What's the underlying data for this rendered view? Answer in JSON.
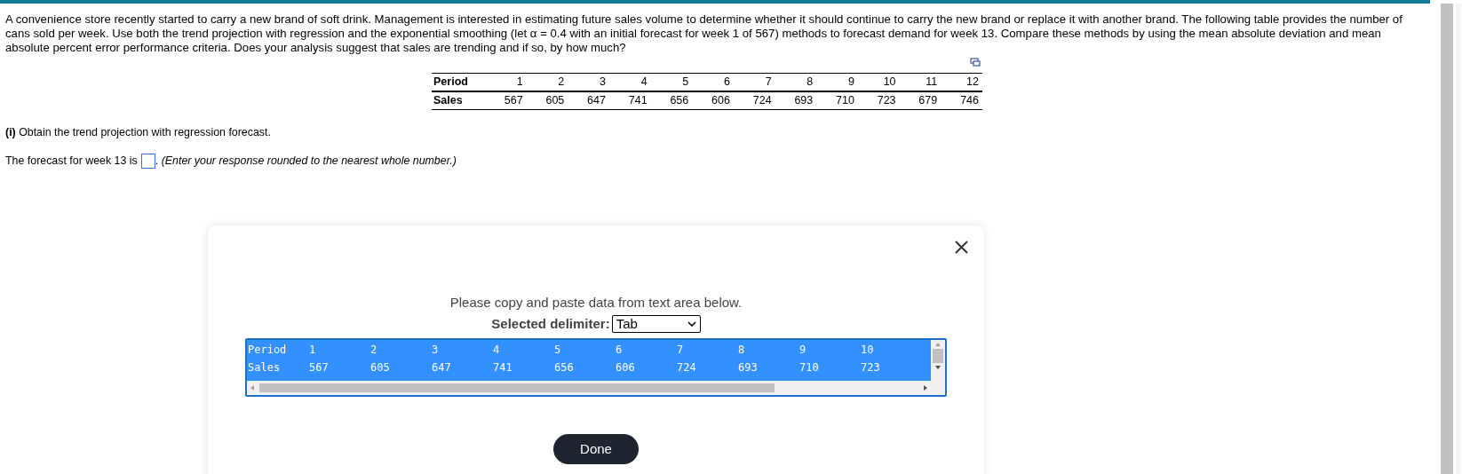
{
  "question": {
    "text": "A convenience store recently started to carry a new brand of soft drink. Management is interested in estimating future sales volume to determine whether it should continue to carry the new brand or replace it with another brand. The following table provides the number of cans sold per week. Use both the trend projection with regression and the exponential smoothing (let α = 0.4 with an initial forecast for week 1 of 567) methods to forecast demand for week 13. Compare these methods by using the mean absolute deviation and mean absolute percent error performance criteria. Does your analysis suggest that sales are trending and if so, by how much?"
  },
  "data_table": {
    "rows": [
      {
        "label": "Period",
        "cells": [
          "1",
          "2",
          "3",
          "4",
          "5",
          "6",
          "7",
          "8",
          "9",
          "10",
          "11",
          "12"
        ]
      },
      {
        "label": "Sales",
        "cells": [
          "567",
          "605",
          "647",
          "741",
          "656",
          "606",
          "724",
          "693",
          "710",
          "723",
          "679",
          "746"
        ]
      }
    ]
  },
  "part": {
    "marker": "(i)",
    "text": "Obtain the trend projection with regression forecast."
  },
  "answer": {
    "before": "The forecast for week 13 is",
    "after": ". ",
    "hint": "(Enter your response rounded to the nearest whole number.)"
  },
  "dialog": {
    "instruction": "Please copy and paste data from text area below.",
    "delimiter_label": "Selected delimiter:",
    "delimiter_value": "Tab",
    "text_area": {
      "selected": true,
      "rows": [
        [
          "Period",
          "1",
          "2",
          "3",
          "4",
          "5",
          "6",
          "7",
          "8",
          "9",
          "10"
        ],
        [
          "Sales",
          "567",
          "605",
          "647",
          "741",
          "656",
          "606",
          "724",
          "693",
          "710",
          "723"
        ]
      ]
    },
    "done_button": "Done"
  }
}
